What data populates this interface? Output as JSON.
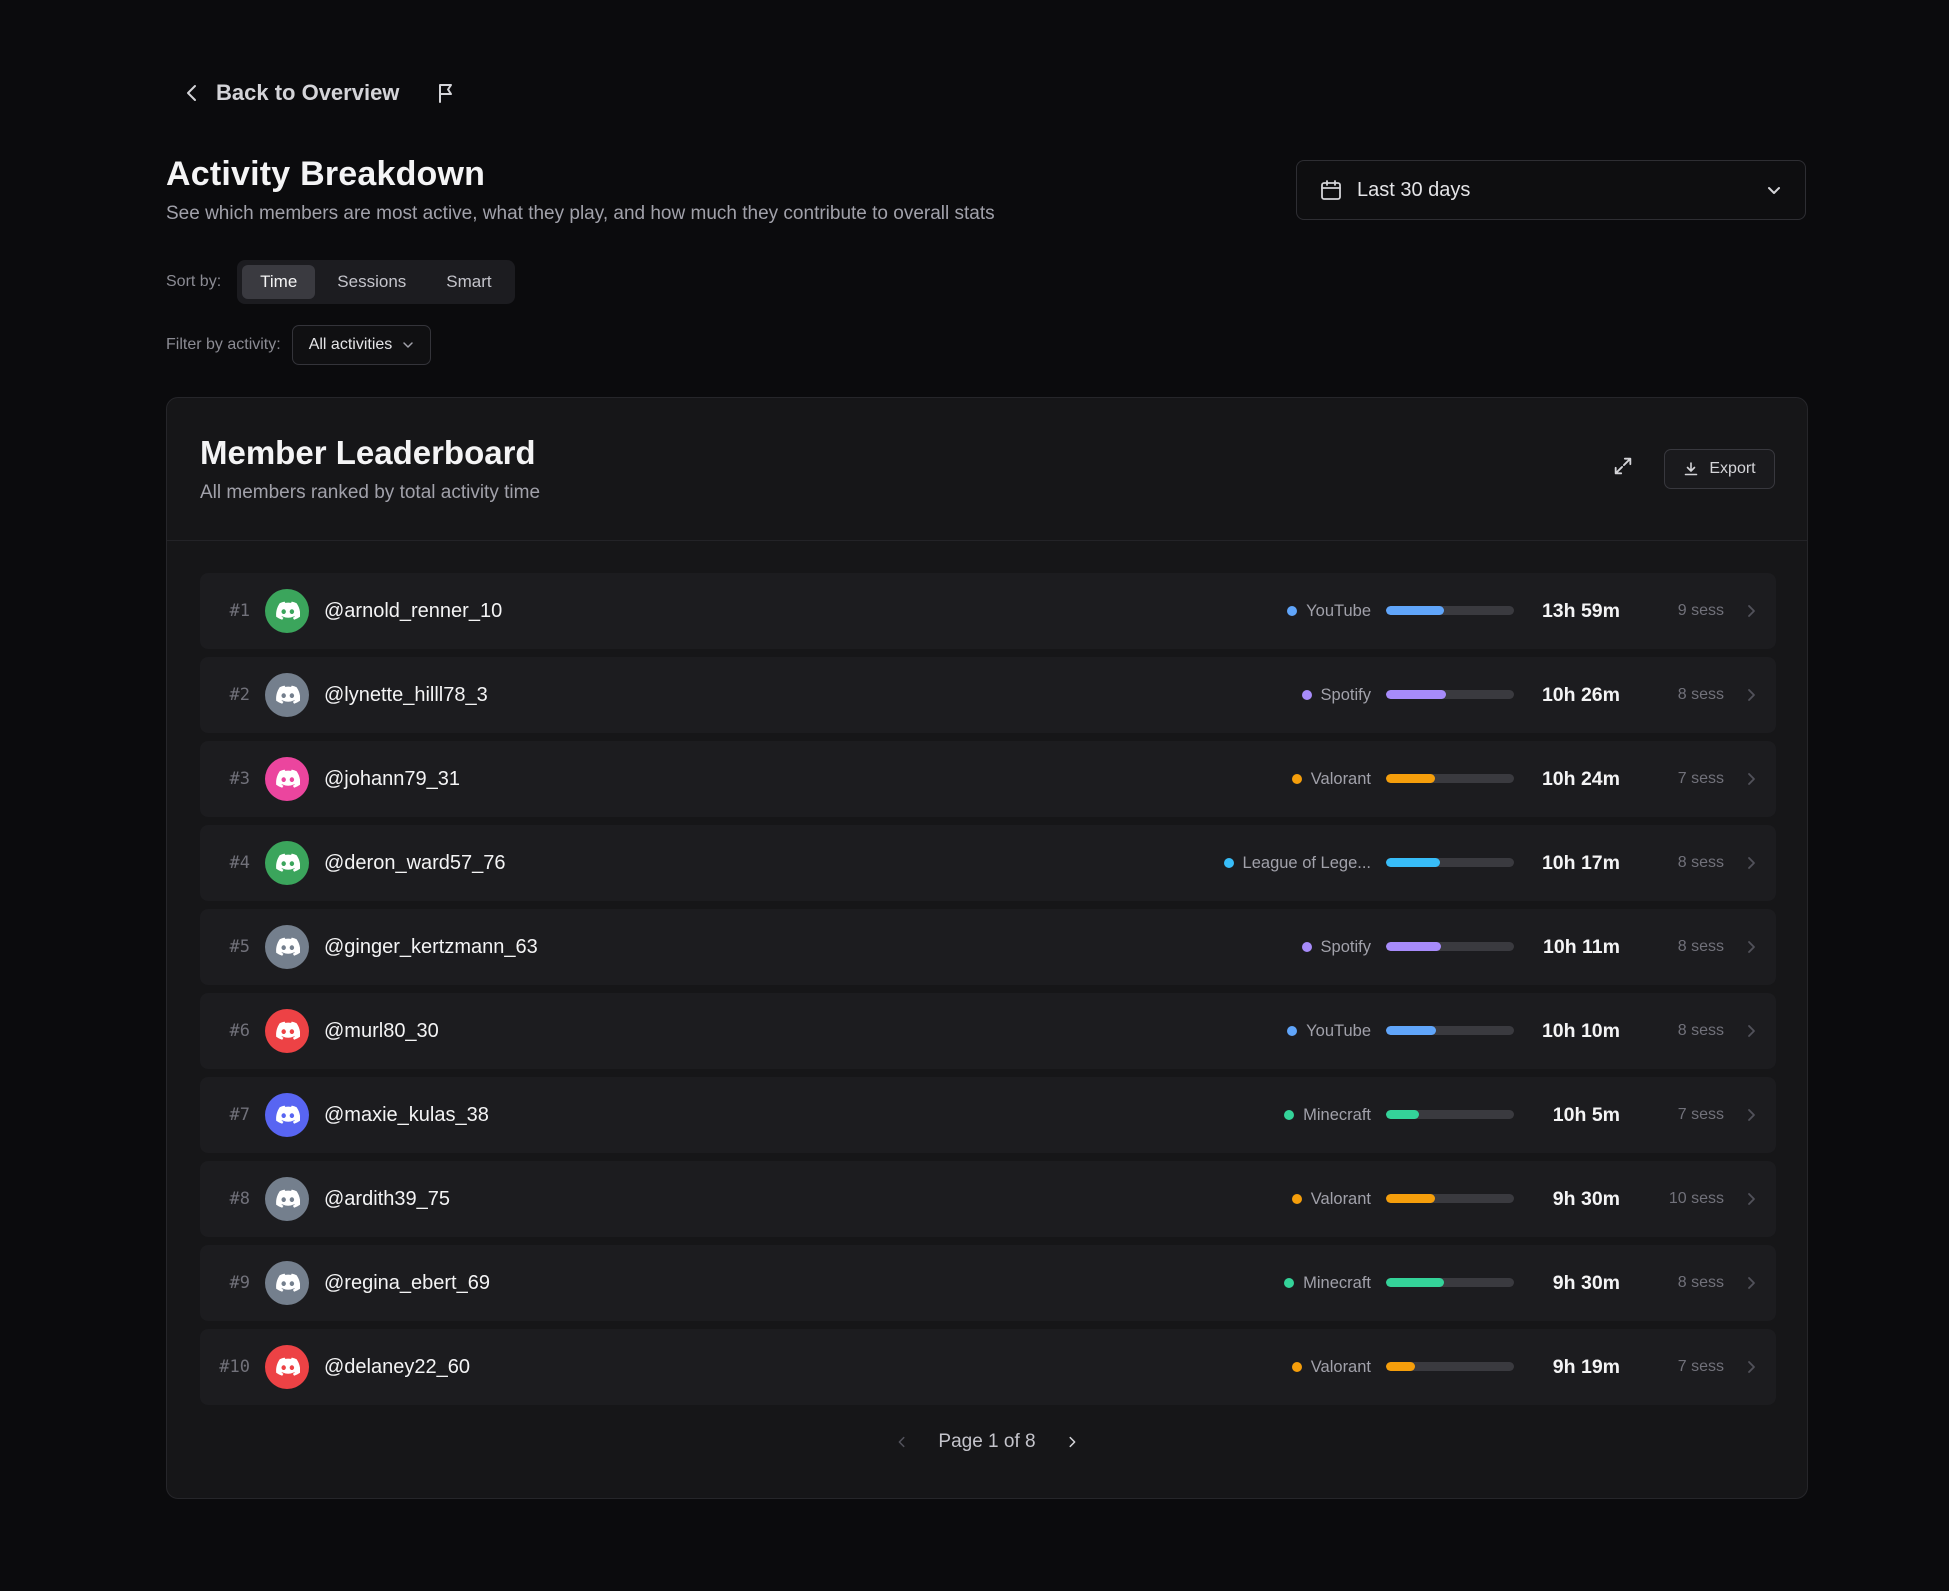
{
  "nav": {
    "back_label": "Back to Overview"
  },
  "header": {
    "title": "Activity Breakdown",
    "subtitle": "See which members are most active, what they play, and how much they contribute to overall stats"
  },
  "date_range": {
    "selected": "Last 30 days"
  },
  "sort": {
    "label": "Sort by:",
    "options": [
      "Time",
      "Sessions",
      "Smart"
    ],
    "selected": "Time"
  },
  "filter": {
    "label": "Filter by activity:",
    "selected": "All activities"
  },
  "leaderboard": {
    "title": "Member Leaderboard",
    "subtitle": "All members ranked by total activity time",
    "export_label": "Export",
    "members": [
      {
        "rank": "#1",
        "username": "@arnold_renner_10",
        "avatar_color": "#3ba55c",
        "activity": "YouTube",
        "activity_color": "#60a5fa",
        "share": 0.45,
        "time": "13h 59m",
        "sessions": "9 sess"
      },
      {
        "rank": "#2",
        "username": "@lynette_hilll78_3",
        "avatar_color": "#747f8d",
        "activity": "Spotify",
        "activity_color": "#a78bfa",
        "share": 0.47,
        "time": "10h 26m",
        "sessions": "8 sess"
      },
      {
        "rank": "#3",
        "username": "@johann79_31",
        "avatar_color": "#eb459e",
        "activity": "Valorant",
        "activity_color": "#f59e0b",
        "share": 0.38,
        "time": "10h 24m",
        "sessions": "7 sess"
      },
      {
        "rank": "#4",
        "username": "@deron_ward57_76",
        "avatar_color": "#3ba55c",
        "activity": "League of Lege...",
        "activity_color": "#38bdf8",
        "share": 0.42,
        "time": "10h 17m",
        "sessions": "8 sess"
      },
      {
        "rank": "#5",
        "username": "@ginger_kertzmann_63",
        "avatar_color": "#747f8d",
        "activity": "Spotify",
        "activity_color": "#a78bfa",
        "share": 0.43,
        "time": "10h 11m",
        "sessions": "8 sess"
      },
      {
        "rank": "#6",
        "username": "@murl80_30",
        "avatar_color": "#ed4245",
        "activity": "YouTube",
        "activity_color": "#60a5fa",
        "share": 0.39,
        "time": "10h 10m",
        "sessions": "8 sess"
      },
      {
        "rank": "#7",
        "username": "@maxie_kulas_38",
        "avatar_color": "#5865f2",
        "activity": "Minecraft",
        "activity_color": "#34d399",
        "share": 0.26,
        "time": "10h 5m",
        "sessions": "7 sess"
      },
      {
        "rank": "#8",
        "username": "@ardith39_75",
        "avatar_color": "#747f8d",
        "activity": "Valorant",
        "activity_color": "#f59e0b",
        "share": 0.38,
        "time": "9h 30m",
        "sessions": "10 sess"
      },
      {
        "rank": "#9",
        "username": "@regina_ebert_69",
        "avatar_color": "#747f8d",
        "activity": "Minecraft",
        "activity_color": "#34d399",
        "share": 0.45,
        "time": "9h 30m",
        "sessions": "8 sess"
      },
      {
        "rank": "#10",
        "username": "@delaney22_60",
        "avatar_color": "#ed4245",
        "activity": "Valorant",
        "activity_color": "#f59e0b",
        "share": 0.23,
        "time": "9h 19m",
        "sessions": "7 sess"
      }
    ]
  },
  "pagination": {
    "label": "Page 1 of 8"
  },
  "icons": {
    "back": "chevron-left-icon",
    "flag": "flag-icon",
    "calendar": "calendar-icon",
    "expand": "expand-icon",
    "export": "download-icon",
    "avatar": "discord-logo-icon",
    "row": "chevron-right-icon"
  }
}
